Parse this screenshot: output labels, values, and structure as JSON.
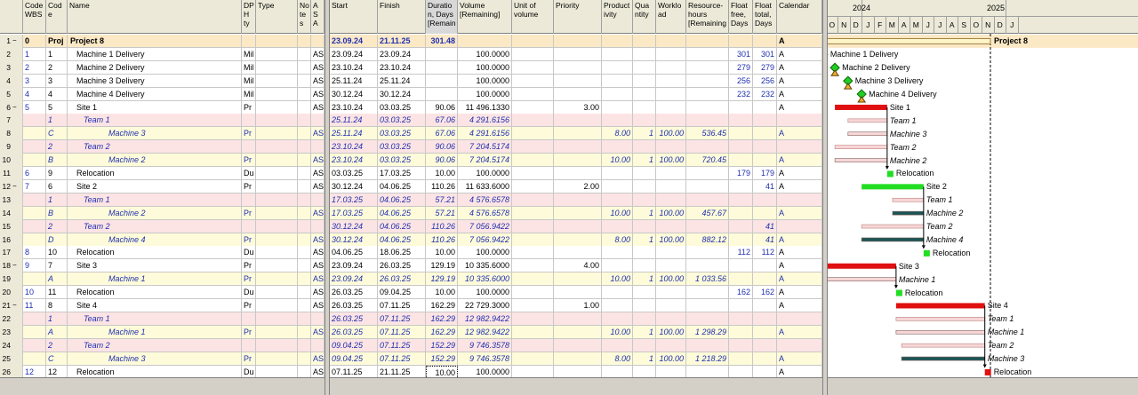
{
  "columns_left": [
    {
      "key": "code_wbs",
      "label": "Code\nWBS"
    },
    {
      "key": "code",
      "label": "Cod\ne"
    },
    {
      "key": "name",
      "label": "Name"
    },
    {
      "key": "dph",
      "label": "DP\nH\nty"
    },
    {
      "key": "type",
      "label": "Type"
    },
    {
      "key": "notes",
      "label": "No\nte\ns"
    },
    {
      "key": "asa",
      "label": "A\nS\nA"
    }
  ],
  "columns_right": [
    {
      "key": "start",
      "label": "Start"
    },
    {
      "key": "finish",
      "label": "Finish"
    },
    {
      "key": "duration",
      "label": "Duratio\nn, Days\n[Remain"
    },
    {
      "key": "volume",
      "label": "Volume\n[Remaining]"
    },
    {
      "key": "unit",
      "label": "Unit of\nvolume"
    },
    {
      "key": "priority",
      "label": "Priority"
    },
    {
      "key": "productivity",
      "label": "Product\nivity"
    },
    {
      "key": "quantity",
      "label": "Qua\nntity"
    },
    {
      "key": "workload",
      "label": "Worklo\nad"
    },
    {
      "key": "resource_hours",
      "label": "Resource-\nhours\n[Remaining"
    },
    {
      "key": "float_free",
      "label": "Float\nfree,\nDays"
    },
    {
      "key": "float_total",
      "label": "Float\ntotal,\nDays"
    },
    {
      "key": "calendar",
      "label": "Calendar"
    }
  ],
  "years": [
    "2024",
    "2025"
  ],
  "months": [
    "O",
    "N",
    "D",
    "J",
    "F",
    "M",
    "A",
    "M",
    "J",
    "J",
    "A",
    "S",
    "O",
    "N",
    "D",
    "J"
  ],
  "rows": [
    {
      "n": "1",
      "exp": "−",
      "wbs": "0",
      "code": "Proj",
      "name": "Project 8",
      "dph": "",
      "type": "",
      "notes": "",
      "asa": "",
      "start": "23.09.24",
      "finish": "21.11.25",
      "duration": "301.48",
      "volume": "",
      "unit": "",
      "priority": "",
      "productivity": "",
      "quantity": "",
      "workload": "",
      "resource_hours": "",
      "float_free": "",
      "float_total": "",
      "calendar": "A",
      "kind": "project",
      "gantt_label": "Project 8"
    },
    {
      "n": "2",
      "exp": "",
      "wbs": "1",
      "code": "1",
      "name": "Machine 1 Delivery",
      "dph": "Mil",
      "type": "",
      "notes": "",
      "asa": "AS",
      "start": "23.09.24",
      "finish": "23.09.24",
      "duration": "",
      "volume": "100.0000",
      "unit": "",
      "priority": "",
      "productivity": "",
      "quantity": "",
      "workload": "",
      "resource_hours": "",
      "float_free": "301",
      "float_total": "301",
      "calendar": "A",
      "kind": "normal",
      "gantt_label": "Machine 1 Delivery"
    },
    {
      "n": "3",
      "exp": "",
      "wbs": "2",
      "code": "2",
      "name": "Machine 2 Delivery",
      "dph": "Mil",
      "type": "",
      "notes": "",
      "asa": "AS",
      "start": "23.10.24",
      "finish": "23.10.24",
      "duration": "",
      "volume": "100.0000",
      "unit": "",
      "priority": "",
      "productivity": "",
      "quantity": "",
      "workload": "",
      "resource_hours": "",
      "float_free": "279",
      "float_total": "279",
      "calendar": "A",
      "kind": "normal",
      "gantt_label": "Machine 2 Delivery"
    },
    {
      "n": "4",
      "exp": "",
      "wbs": "3",
      "code": "3",
      "name": "Machine 3 Delivery",
      "dph": "Mil",
      "type": "",
      "notes": "",
      "asa": "AS",
      "start": "25.11.24",
      "finish": "25.11.24",
      "duration": "",
      "volume": "100.0000",
      "unit": "",
      "priority": "",
      "productivity": "",
      "quantity": "",
      "workload": "",
      "resource_hours": "",
      "float_free": "256",
      "float_total": "256",
      "calendar": "A",
      "kind": "normal",
      "gantt_label": "Machine 3 Delivery"
    },
    {
      "n": "5",
      "exp": "",
      "wbs": "4",
      "code": "4",
      "name": "Machine 4 Delivery",
      "dph": "Mil",
      "type": "",
      "notes": "",
      "asa": "AS",
      "start": "30.12.24",
      "finish": "30.12.24",
      "duration": "",
      "volume": "100.0000",
      "unit": "",
      "priority": "",
      "productivity": "",
      "quantity": "",
      "workload": "",
      "resource_hours": "",
      "float_free": "232",
      "float_total": "232",
      "calendar": "A",
      "kind": "normal",
      "gantt_label": "Machine 4 Delivery"
    },
    {
      "n": "6",
      "exp": "−",
      "wbs": "5",
      "code": "5",
      "name": "Site 1",
      "dph": "Pr",
      "type": "",
      "notes": "",
      "asa": "AS",
      "start": "23.10.24",
      "finish": "03.03.25",
      "duration": "90.06",
      "volume": "11 496.1330",
      "unit": "",
      "priority": "3.00",
      "productivity": "",
      "quantity": "",
      "workload": "",
      "resource_hours": "",
      "float_free": "",
      "float_total": "",
      "calendar": "A",
      "kind": "normal",
      "gantt_label": "Site 1"
    },
    {
      "n": "7",
      "exp": "",
      "wbs": "",
      "code": "1",
      "name": "Team 1",
      "dph": "",
      "type": "",
      "notes": "",
      "asa": "",
      "start": "25.11.24",
      "finish": "03.03.25",
      "duration": "67.06",
      "volume": "4 291.6156",
      "unit": "",
      "priority": "",
      "productivity": "",
      "quantity": "",
      "workload": "",
      "resource_hours": "",
      "float_free": "",
      "float_total": "",
      "calendar": "",
      "kind": "team",
      "gantt_label": "Team 1"
    },
    {
      "n": "8",
      "exp": "",
      "wbs": "",
      "code": "C",
      "name": "Machine 3",
      "dph": "Pr",
      "type": "",
      "notes": "",
      "asa": "AS",
      "start": "25.11.24",
      "finish": "03.03.25",
      "duration": "67.06",
      "volume": "4 291.6156",
      "unit": "",
      "priority": "",
      "productivity": "8.00",
      "quantity": "1",
      "workload": "100.00",
      "resource_hours": "536.45",
      "float_free": "",
      "float_total": "",
      "calendar": "A",
      "kind": "machine",
      "gantt_label": "Machine 3"
    },
    {
      "n": "9",
      "exp": "",
      "wbs": "",
      "code": "2",
      "name": "Team 2",
      "dph": "",
      "type": "",
      "notes": "",
      "asa": "",
      "start": "23.10.24",
      "finish": "03.03.25",
      "duration": "90.06",
      "volume": "7 204.5174",
      "unit": "",
      "priority": "",
      "productivity": "",
      "quantity": "",
      "workload": "",
      "resource_hours": "",
      "float_free": "",
      "float_total": "",
      "calendar": "",
      "kind": "team",
      "gantt_label": "Team 2"
    },
    {
      "n": "10",
      "exp": "",
      "wbs": "",
      "code": "B",
      "name": "Machine 2",
      "dph": "Pr",
      "type": "",
      "notes": "",
      "asa": "AS",
      "start": "23.10.24",
      "finish": "03.03.25",
      "duration": "90.06",
      "volume": "7 204.5174",
      "unit": "",
      "priority": "",
      "productivity": "10.00",
      "quantity": "1",
      "workload": "100.00",
      "resource_hours": "720.45",
      "float_free": "",
      "float_total": "",
      "calendar": "A",
      "kind": "machine",
      "gantt_label": "Machine 2"
    },
    {
      "n": "11",
      "exp": "",
      "wbs": "6",
      "code": "9",
      "name": "Relocation",
      "dph": "Du",
      "type": "",
      "notes": "",
      "asa": "AS",
      "start": "03.03.25",
      "finish": "17.03.25",
      "duration": "10.00",
      "volume": "100.0000",
      "unit": "",
      "priority": "",
      "productivity": "",
      "quantity": "",
      "workload": "",
      "resource_hours": "",
      "float_free": "179",
      "float_total": "179",
      "calendar": "A",
      "kind": "normal",
      "gantt_label": "Relocation"
    },
    {
      "n": "12",
      "exp": "−",
      "wbs": "7",
      "code": "6",
      "name": "Site 2",
      "dph": "Pr",
      "type": "",
      "notes": "",
      "asa": "AS",
      "start": "30.12.24",
      "finish": "04.06.25",
      "duration": "110.26",
      "volume": "11 633.6000",
      "unit": "",
      "priority": "2.00",
      "productivity": "",
      "quantity": "",
      "workload": "",
      "resource_hours": "",
      "float_free": "",
      "float_total": "41",
      "calendar": "A",
      "kind": "normal",
      "gantt_label": "Site 2"
    },
    {
      "n": "13",
      "exp": "",
      "wbs": "",
      "code": "1",
      "name": "Team 1",
      "dph": "",
      "type": "",
      "notes": "",
      "asa": "",
      "start": "17.03.25",
      "finish": "04.06.25",
      "duration": "57.21",
      "volume": "4 576.6578",
      "unit": "",
      "priority": "",
      "productivity": "",
      "quantity": "",
      "workload": "",
      "resource_hours": "",
      "float_free": "",
      "float_total": "",
      "calendar": "",
      "kind": "team",
      "gantt_label": "Team 1"
    },
    {
      "n": "14",
      "exp": "",
      "wbs": "",
      "code": "B",
      "name": "Machine 2",
      "dph": "Pr",
      "type": "",
      "notes": "",
      "asa": "AS",
      "start": "17.03.25",
      "finish": "04.06.25",
      "duration": "57.21",
      "volume": "4 576.6578",
      "unit": "",
      "priority": "",
      "productivity": "10.00",
      "quantity": "1",
      "workload": "100.00",
      "resource_hours": "457.67",
      "float_free": "",
      "float_total": "",
      "calendar": "A",
      "kind": "machine",
      "gantt_label": "Machine 2"
    },
    {
      "n": "15",
      "exp": "",
      "wbs": "",
      "code": "2",
      "name": "Team 2",
      "dph": "",
      "type": "",
      "notes": "",
      "asa": "",
      "start": "30.12.24",
      "finish": "04.06.25",
      "duration": "110.26",
      "volume": "7 056.9422",
      "unit": "",
      "priority": "",
      "productivity": "",
      "quantity": "",
      "workload": "",
      "resource_hours": "",
      "float_free": "",
      "float_total": "41",
      "calendar": "",
      "kind": "team",
      "gantt_label": "Team 2"
    },
    {
      "n": "16",
      "exp": "",
      "wbs": "",
      "code": "D",
      "name": "Machine 4",
      "dph": "Pr",
      "type": "",
      "notes": "",
      "asa": "AS",
      "start": "30.12.24",
      "finish": "04.06.25",
      "duration": "110.26",
      "volume": "7 056.9422",
      "unit": "",
      "priority": "",
      "productivity": "8.00",
      "quantity": "1",
      "workload": "100.00",
      "resource_hours": "882.12",
      "float_free": "",
      "float_total": "41",
      "calendar": "A",
      "kind": "machine",
      "gantt_label": "Machine 4"
    },
    {
      "n": "17",
      "exp": "",
      "wbs": "8",
      "code": "10",
      "name": "Relocation",
      "dph": "Du",
      "type": "",
      "notes": "",
      "asa": "AS",
      "start": "04.06.25",
      "finish": "18.06.25",
      "duration": "10.00",
      "volume": "100.0000",
      "unit": "",
      "priority": "",
      "productivity": "",
      "quantity": "",
      "workload": "",
      "resource_hours": "",
      "float_free": "112",
      "float_total": "112",
      "calendar": "A",
      "kind": "normal",
      "gantt_label": "Relocation"
    },
    {
      "n": "18",
      "exp": "−",
      "wbs": "9",
      "code": "7",
      "name": "Site 3",
      "dph": "Pr",
      "type": "",
      "notes": "",
      "asa": "AS",
      "start": "23.09.24",
      "finish": "26.03.25",
      "duration": "129.19",
      "volume": "10 335.6000",
      "unit": "",
      "priority": "4.00",
      "productivity": "",
      "quantity": "",
      "workload": "",
      "resource_hours": "",
      "float_free": "",
      "float_total": "",
      "calendar": "A",
      "kind": "normal",
      "gantt_label": "Site 3"
    },
    {
      "n": "19",
      "exp": "",
      "wbs": "",
      "code": "A",
      "name": "Machine 1",
      "dph": "Pr",
      "type": "",
      "notes": "",
      "asa": "AS",
      "start": "23.09.24",
      "finish": "26.03.25",
      "duration": "129.19",
      "volume": "10 335.6000",
      "unit": "",
      "priority": "",
      "productivity": "10.00",
      "quantity": "1",
      "workload": "100.00",
      "resource_hours": "1 033.56",
      "float_free": "",
      "float_total": "",
      "calendar": "A",
      "kind": "machine",
      "gantt_label": "Machine 1"
    },
    {
      "n": "20",
      "exp": "",
      "wbs": "10",
      "code": "11",
      "name": "Relocation",
      "dph": "Du",
      "type": "",
      "notes": "",
      "asa": "AS",
      "start": "26.03.25",
      "finish": "09.04.25",
      "duration": "10.00",
      "volume": "100.0000",
      "unit": "",
      "priority": "",
      "productivity": "",
      "quantity": "",
      "workload": "",
      "resource_hours": "",
      "float_free": "162",
      "float_total": "162",
      "calendar": "A",
      "kind": "normal",
      "gantt_label": "Relocation"
    },
    {
      "n": "21",
      "exp": "−",
      "wbs": "11",
      "code": "8",
      "name": "Site 4",
      "dph": "Pr",
      "type": "",
      "notes": "",
      "asa": "AS",
      "start": "26.03.25",
      "finish": "07.11.25",
      "duration": "162.29",
      "volume": "22 729.3000",
      "unit": "",
      "priority": "1.00",
      "productivity": "",
      "quantity": "",
      "workload": "",
      "resource_hours": "",
      "float_free": "",
      "float_total": "",
      "calendar": "A",
      "kind": "normal",
      "gantt_label": "Site 4"
    },
    {
      "n": "22",
      "exp": "",
      "wbs": "",
      "code": "1",
      "name": "Team 1",
      "dph": "",
      "type": "",
      "notes": "",
      "asa": "",
      "start": "26.03.25",
      "finish": "07.11.25",
      "duration": "162.29",
      "volume": "12 982.9422",
      "unit": "",
      "priority": "",
      "productivity": "",
      "quantity": "",
      "workload": "",
      "resource_hours": "",
      "float_free": "",
      "float_total": "",
      "calendar": "",
      "kind": "team",
      "gantt_label": "Team 1"
    },
    {
      "n": "23",
      "exp": "",
      "wbs": "",
      "code": "A",
      "name": "Machine 1",
      "dph": "Pr",
      "type": "",
      "notes": "",
      "asa": "AS",
      "start": "26.03.25",
      "finish": "07.11.25",
      "duration": "162.29",
      "volume": "12 982.9422",
      "unit": "",
      "priority": "",
      "productivity": "10.00",
      "quantity": "1",
      "workload": "100.00",
      "resource_hours": "1 298.29",
      "float_free": "",
      "float_total": "",
      "calendar": "A",
      "kind": "machine",
      "gantt_label": "Machine 1"
    },
    {
      "n": "24",
      "exp": "",
      "wbs": "",
      "code": "2",
      "name": "Team 2",
      "dph": "",
      "type": "",
      "notes": "",
      "asa": "",
      "start": "09.04.25",
      "finish": "07.11.25",
      "duration": "152.29",
      "volume": "9 746.3578",
      "unit": "",
      "priority": "",
      "productivity": "",
      "quantity": "",
      "workload": "",
      "resource_hours": "",
      "float_free": "",
      "float_total": "",
      "calendar": "",
      "kind": "team",
      "gantt_label": "Team 2"
    },
    {
      "n": "25",
      "exp": "",
      "wbs": "",
      "code": "C",
      "name": "Machine 3",
      "dph": "Pr",
      "type": "",
      "notes": "",
      "asa": "AS",
      "start": "09.04.25",
      "finish": "07.11.25",
      "duration": "152.29",
      "volume": "9 746.3578",
      "unit": "",
      "priority": "",
      "productivity": "8.00",
      "quantity": "1",
      "workload": "100.00",
      "resource_hours": "1 218.29",
      "float_free": "",
      "float_total": "",
      "calendar": "A",
      "kind": "machine",
      "gantt_label": "Machine 3"
    },
    {
      "n": "26",
      "exp": "",
      "wbs": "12",
      "code": "12",
      "name": "Relocation",
      "dph": "Du",
      "type": "",
      "notes": "",
      "asa": "AS",
      "start": "07.11.25",
      "finish": "21.11.25",
      "duration": "10.00",
      "volume": "100.0000",
      "unit": "",
      "priority": "",
      "productivity": "",
      "quantity": "",
      "workload": "",
      "resource_hours": "",
      "float_free": "",
      "float_total": "",
      "calendar": "A",
      "kind": "normal",
      "gantt_label": "Relocation"
    }
  ],
  "colors": {
    "project_row": "#fbe9c6",
    "team_row": "#fce4e4",
    "machine_row": "#fdfbd9",
    "critical_bar": "#e01010",
    "normal_bar": "#22dd22",
    "team_bar": "#f6d6d6",
    "machine_bar": "#1a5555",
    "milestone": "#22cc22",
    "link": "#000000"
  }
}
